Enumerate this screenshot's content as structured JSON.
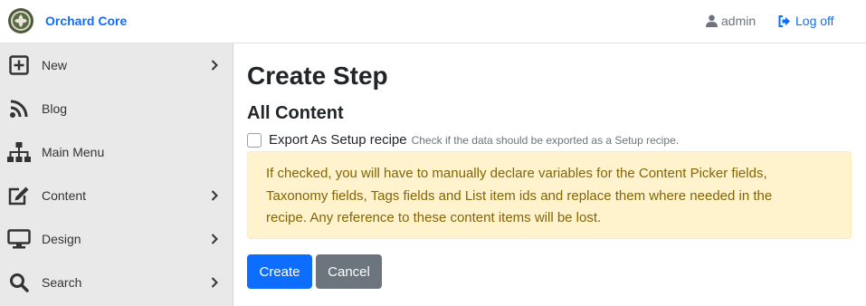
{
  "header": {
    "brand": "Orchard Core",
    "user": "admin",
    "logoff": "Log off"
  },
  "sidebar": {
    "items": [
      {
        "label": "New",
        "icon": "plus-square-icon",
        "has_submenu": true
      },
      {
        "label": "Blog",
        "icon": "rss-icon",
        "has_submenu": false
      },
      {
        "label": "Main Menu",
        "icon": "sitemap-icon",
        "has_submenu": false
      },
      {
        "label": "Content",
        "icon": "edit-icon",
        "has_submenu": true
      },
      {
        "label": "Design",
        "icon": "desktop-icon",
        "has_submenu": true
      },
      {
        "label": "Search",
        "icon": "search-icon",
        "has_submenu": true
      }
    ]
  },
  "main": {
    "title": "Create Step",
    "subtitle": "All Content",
    "checkbox_label": "Export As Setup recipe",
    "checkbox_hint": "Check if the data should be exported as a Setup recipe.",
    "checkbox_checked": false,
    "alert_lines": [
      "If checked, you will have to manually declare variables for the Content Picker fields,",
      "Taxonomy fields, Tags fields and List item ids and replace them where needed in the",
      "recipe. Any reference to these content items will be lost."
    ],
    "create_label": "Create",
    "cancel_label": "Cancel"
  },
  "colors": {
    "primary": "#0d6efd",
    "secondary": "#6c757d",
    "alert_bg": "#fff3cd",
    "alert_text": "#856404",
    "sidebar_bg": "#e9e9e9"
  }
}
